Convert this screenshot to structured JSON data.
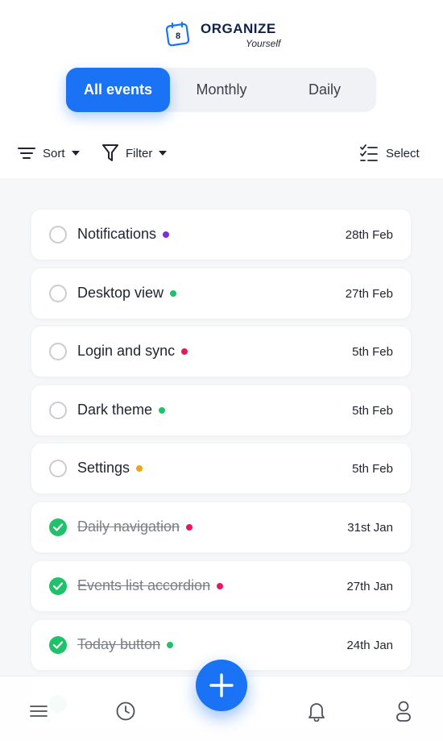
{
  "app": {
    "title": "ORGANIZE",
    "subtitle": "Yourself",
    "logo_day": "8"
  },
  "tabs": [
    {
      "label": "All events",
      "active": true
    },
    {
      "label": "Monthly",
      "active": false
    },
    {
      "label": "Daily",
      "active": false
    }
  ],
  "toolbar": {
    "sort_label": "Sort",
    "filter_label": "Filter",
    "select_label": "Select"
  },
  "events": [
    {
      "title": "Notifications",
      "date": "28th Feb",
      "done": false,
      "color": "#7b2fd8"
    },
    {
      "title": "Desktop view",
      "date": "27th Feb",
      "done": false,
      "color": "#1fc16b"
    },
    {
      "title": "Login and sync",
      "date": "5th Feb",
      "done": false,
      "color": "#e8195a"
    },
    {
      "title": "Dark theme",
      "date": "5th Feb",
      "done": false,
      "color": "#1fc16b"
    },
    {
      "title": "Settings",
      "date": "5th Feb",
      "done": false,
      "color": "#f2a21a"
    },
    {
      "title": "Daily navigation",
      "date": "31st Jan",
      "done": true,
      "color": "#e8195a"
    },
    {
      "title": "Events list accordion",
      "date": "27th Jan",
      "done": true,
      "color": "#e8195a"
    },
    {
      "title": "Today button",
      "date": "24th Jan",
      "done": true,
      "color": "#1fc16b"
    }
  ],
  "colors": {
    "accent": "#1a73f5",
    "done": "#1fc16b",
    "brand_text": "#0f2348"
  },
  "nav": {
    "icons": [
      "menu-icon",
      "clock-icon",
      "plus-icon",
      "bell-icon",
      "user-icon"
    ]
  }
}
